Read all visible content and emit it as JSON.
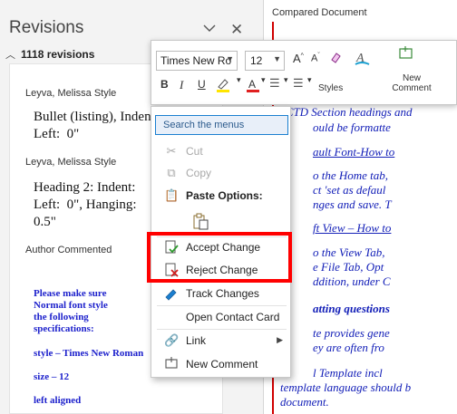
{
  "revisions_pane": {
    "title": "Revisions",
    "count_label": "1118 revisions",
    "items": [
      {
        "author": "Leyva, Melissa",
        "action": "Style",
        "text": "Bullet (listing), Indent:\nLeft:  0\""
      },
      {
        "author": "Leyva, Melissa",
        "action": "Style",
        "text": "Heading 2: Indent:\nLeft:  0\", Hanging:\n0.5\""
      },
      {
        "author": "Author",
        "action": "Commented",
        "comment_lines": [
          "Please make sure",
          "Normal font style",
          "the following",
          "specifications:",
          "",
          "style – Times New Roman",
          "",
          "size – 12",
          "",
          "left aligned"
        ]
      }
    ]
  },
  "document": {
    "header": "Compared Document",
    "lines": [
      "eCTD Section headings and",
      "ould be formatte",
      "ault Font-How to",
      "o the Home tab,",
      "ct 'set as defaul",
      "nges and save.  T",
      "ft View – How to",
      "o the View Tab,",
      "e File Tab, Opt",
      "ddition, under C",
      "atting questions",
      "te provides gene",
      "ey are often fro",
      "l Template incl",
      "template language should b",
      "document."
    ]
  },
  "mini_toolbar": {
    "font_name": "Times New Ro",
    "font_size": "12",
    "styles_label": "Styles",
    "new_comment_label": "New Comment",
    "grow_font": "A",
    "shrink_font": "A"
  },
  "context_menu": {
    "search_placeholder": "Search the menus",
    "items": [
      {
        "label": "Cut",
        "icon": "scissors-icon",
        "enabled": false
      },
      {
        "label": "Copy",
        "icon": "copy-icon",
        "enabled": false
      },
      {
        "label": "Paste Options:",
        "icon": "paste-icon",
        "enabled": true
      },
      {
        "label": "Accept Change",
        "icon": "accept-change-icon",
        "enabled": true
      },
      {
        "label": "Reject Change",
        "icon": "reject-change-icon",
        "enabled": true
      },
      {
        "label": "Track Changes",
        "icon": "track-changes-icon",
        "enabled": true
      },
      {
        "label": "Open Contact Card",
        "icon": "",
        "enabled": true
      },
      {
        "label": "Link",
        "icon": "link-icon",
        "enabled": true
      },
      {
        "label": "New Comment",
        "icon": "new-comment-icon",
        "enabled": true
      }
    ]
  },
  "colors": {
    "highlight_box": "#ff0000",
    "revision_mark": "#d00000",
    "revised_text": "#1420b8"
  }
}
